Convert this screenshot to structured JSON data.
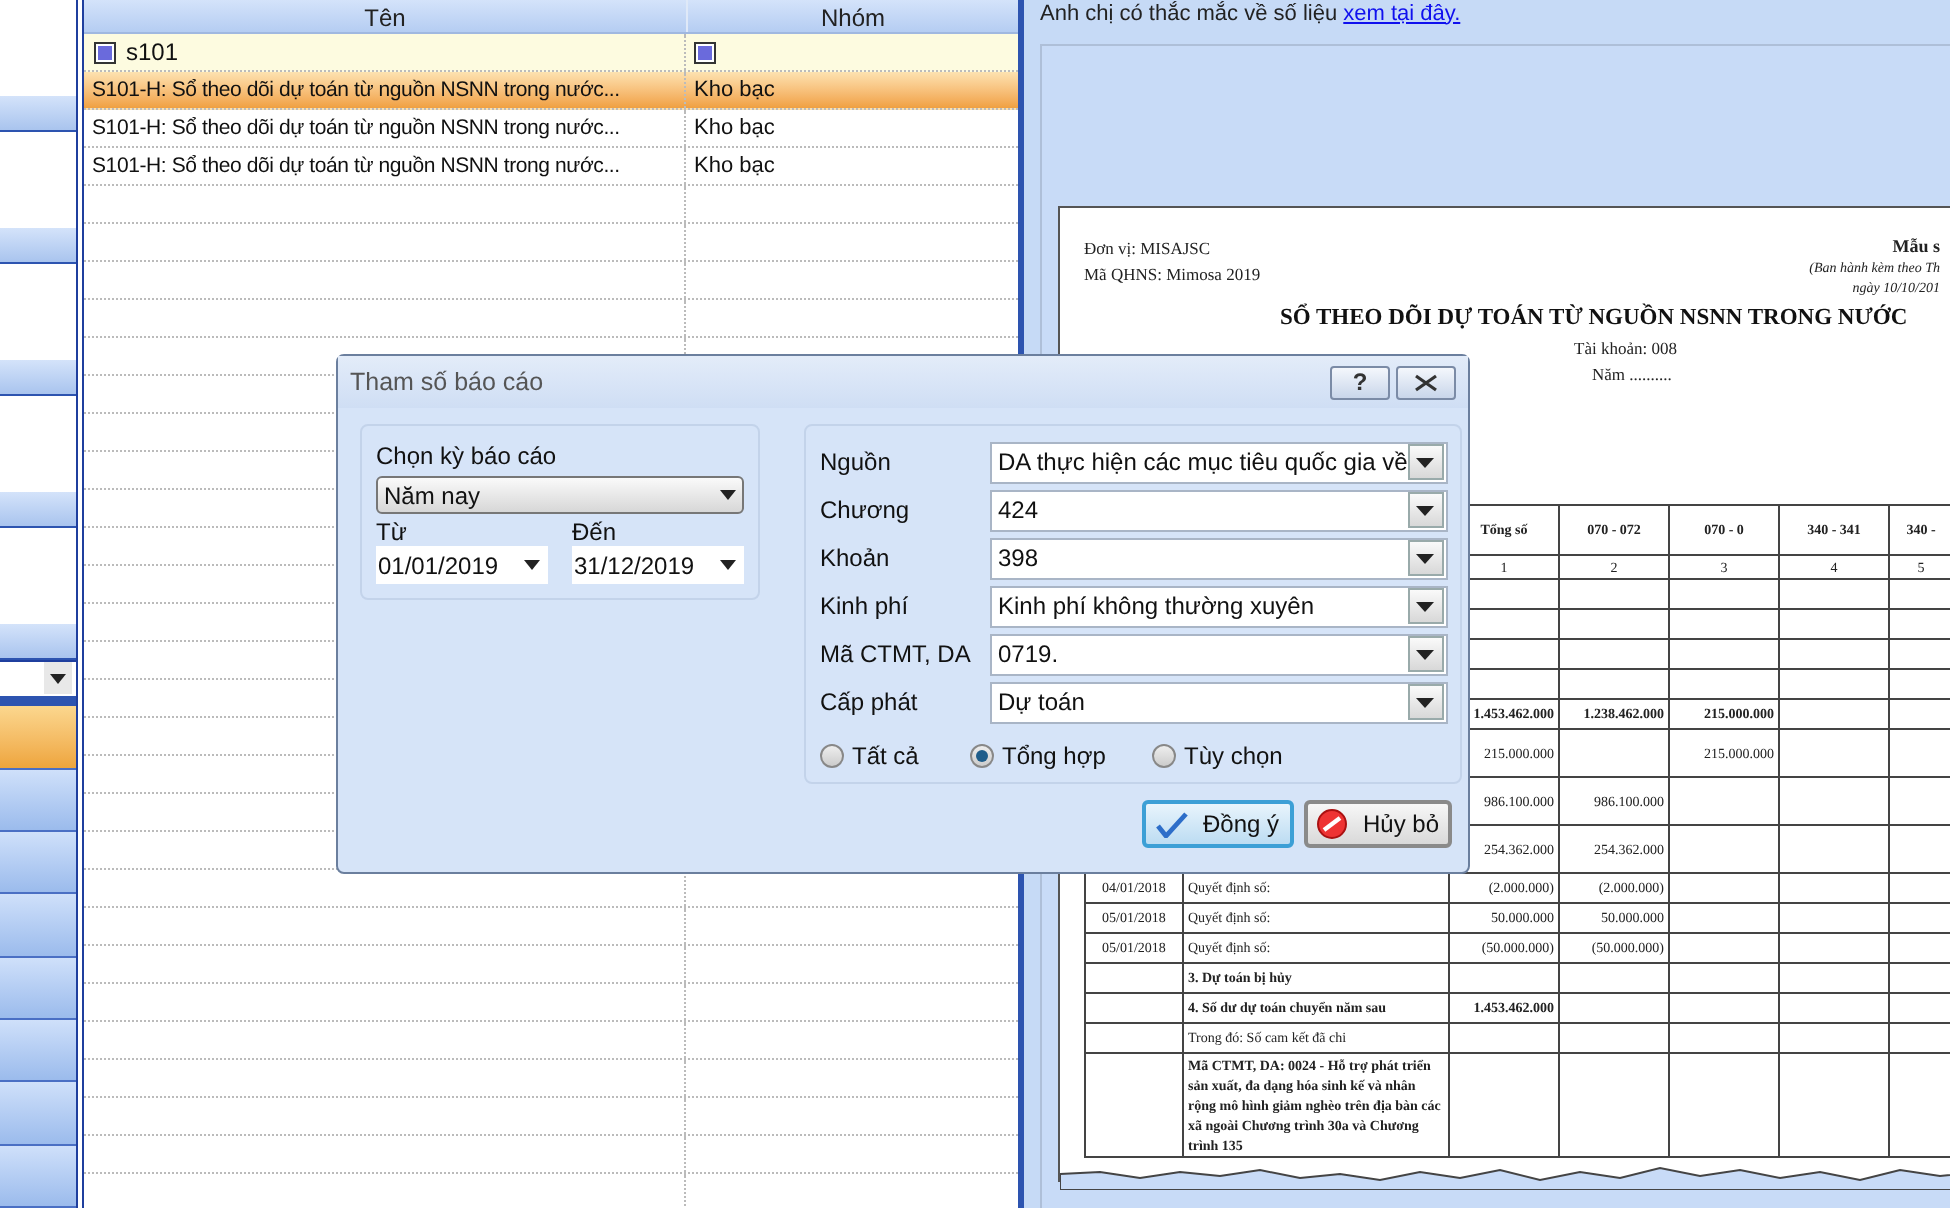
{
  "nav_buttons": [
    {
      "selected": true
    },
    {
      "selected": false
    },
    {
      "selected": false
    },
    {
      "selected": false
    },
    {
      "selected": false
    },
    {
      "selected": false
    },
    {
      "selected": false
    },
    {
      "selected": false
    }
  ],
  "report_list": {
    "columns": [
      "Tên",
      "Nhóm"
    ],
    "filter": {
      "value": "s101"
    },
    "rows": [
      {
        "name": "S101-H: Sổ theo dõi dự toán từ nguồn NSNN trong nước...",
        "group": "Kho bạc",
        "selected": true
      },
      {
        "name": "S101-H: Sổ theo dõi dự toán từ nguồn NSNN trong nước...",
        "group": "Kho bạc",
        "selected": false
      },
      {
        "name": "S101-H: Sổ theo dõi dự toán từ nguồn NSNN trong nước...",
        "group": "Kho bạc",
        "selected": false
      }
    ]
  },
  "preview": {
    "notice": "Anh chị có thắc mắc về số liệu",
    "notice_link": "xem tại đây.",
    "document": {
      "unit": "Đơn vị: MISAJSC",
      "code": "Mã QHNS: Mimosa 2019",
      "form": "Mẫu s",
      "issued": "(Ban hành kèm theo Th",
      "date": "ngày 10/10/201",
      "title": "SỔ THEO DÕI DỰ TOÁN TỪ NGUỒN NSNN TRONG NƯỚC",
      "account": "Tài khoản: 008",
      "year": "Năm ..........",
      "columns": [
        "Tổng số",
        "070 - 072",
        "070 - 0",
        "340 - 341",
        "340 -"
      ],
      "column_numbers": [
        "1",
        "2",
        "3",
        "4",
        "5"
      ],
      "rows": [
        {
          "kind": "blank",
          "cells": []
        },
        {
          "kind": "blank",
          "cells": []
        },
        {
          "kind": "blank",
          "cells": []
        },
        {
          "kind": "blank",
          "cells": []
        },
        {
          "kind": "total",
          "cells": [
            "1.453.462.000",
            "1.238.462.000",
            "215.000.000"
          ]
        },
        {
          "kind": "entry",
          "cells": [
            "215.000.000",
            "",
            "215.000.000"
          ]
        },
        {
          "kind": "entry",
          "cells": [
            "986.100.000",
            "986.100.000"
          ]
        },
        {
          "kind": "entry",
          "cells": [
            "254.362.000",
            "254.362.000"
          ]
        },
        {
          "kind": "decision",
          "date": "04/01/2018",
          "desc": "Quyết định số:",
          "cells": [
            "(2.000.000)",
            "(2.000.000)"
          ]
        },
        {
          "kind": "decision",
          "date": "05/01/2018",
          "desc": "Quyết định số:",
          "cells": [
            "50.000.000",
            "50.000.000"
          ]
        },
        {
          "kind": "decision",
          "date": "05/01/2018",
          "desc": "Quyết định số:",
          "cells": [
            "(50.000.000)",
            "(50.000.000)"
          ]
        },
        {
          "kind": "section",
          "desc": "3. Dự toán bị hủy",
          "cells": []
        },
        {
          "kind": "section",
          "desc": "4. Số dư dự toán chuyển năm sau",
          "cells": [
            "1.453.462.000"
          ]
        },
        {
          "kind": "note",
          "desc": "Trong đó: Số cam kết đã chi",
          "cells": []
        },
        {
          "kind": "program",
          "desc": "Mã CTMT, DA: 0024 - Hỗ trợ phát triển sản xuất, đa dạng hóa sinh kế và nhân rộng mô hình giảm nghèo trên địa bàn các xã ngoài Chương trình 30a và Chương trình 135",
          "cells": []
        }
      ]
    }
  },
  "dialog": {
    "title": "Tham số báo cáo",
    "help_glyph": "?",
    "period": {
      "label": "Chọn kỳ báo cáo",
      "value": "Năm nay"
    },
    "from": {
      "label": "Từ",
      "value": "01/01/2019"
    },
    "to": {
      "label": "Đến",
      "value": "31/12/2019"
    },
    "fields": [
      {
        "label": "Nguồn",
        "value": "DA thực hiện các mục tiêu quốc gia về"
      },
      {
        "label": "Chương",
        "value": "424"
      },
      {
        "label": "Khoản",
        "value": "398"
      },
      {
        "label": "Kinh phí",
        "value": "Kinh phí không thường xuyên"
      },
      {
        "label": "Mã CTMT, DA",
        "value": "0719."
      },
      {
        "label": "Cấp phát",
        "value": "Dự toán"
      }
    ],
    "radios": [
      {
        "label": "Tất cả",
        "selected": false
      },
      {
        "label": "Tổng hợp",
        "selected": true
      },
      {
        "label": "Tùy chọn",
        "selected": false
      }
    ],
    "buttons": [
      {
        "label": "Đồng ý",
        "kind": "ok"
      },
      {
        "label": "Hủy bỏ",
        "kind": "cancel"
      }
    ]
  }
}
